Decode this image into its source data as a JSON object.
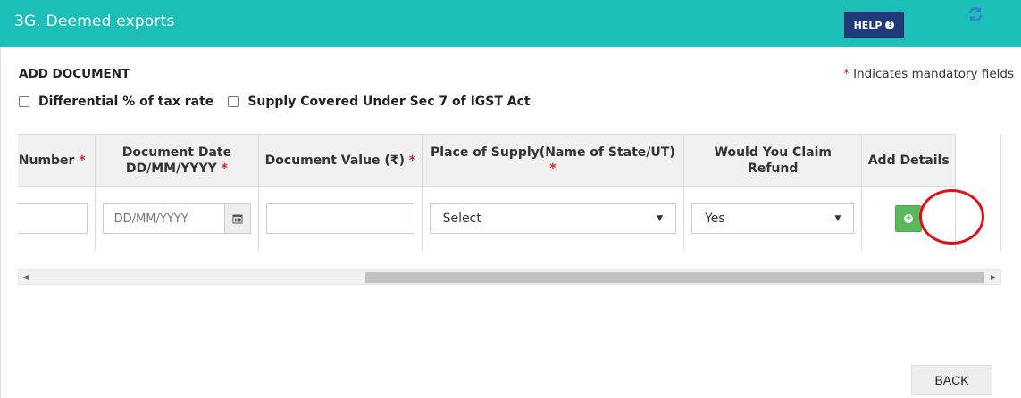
{
  "header": {
    "title": "3G. Deemed exports",
    "help_label": "HELP",
    "help_icon": "question-circle-icon",
    "refresh_icon": "refresh-icon",
    "bg_color": "#1bbfb7"
  },
  "section": {
    "title": "ADD DOCUMENT",
    "mandatory_star": "*",
    "mandatory_note": "Indicates mandatory fields"
  },
  "checkboxes": [
    {
      "label": "Differential % of tax rate",
      "checked": false
    },
    {
      "label": "Supply Covered Under Sec 7 of IGST Act",
      "checked": false
    }
  ],
  "table": {
    "headers": {
      "number": "Number",
      "date_line1": "Document Date",
      "date_line2": "DD/MM/YYYY",
      "value": "Document Value (₹)",
      "place": "Place of Supply(Name of State/UT)",
      "refund": "Would You Claim Refund",
      "add": "Add Details",
      "star": "*"
    },
    "row": {
      "number_value": "",
      "date_placeholder": "DD/MM/YYYY",
      "doc_value": "",
      "place_selected": "Select",
      "refund_selected": "Yes"
    }
  },
  "footer": {
    "back_label": "BACK"
  }
}
